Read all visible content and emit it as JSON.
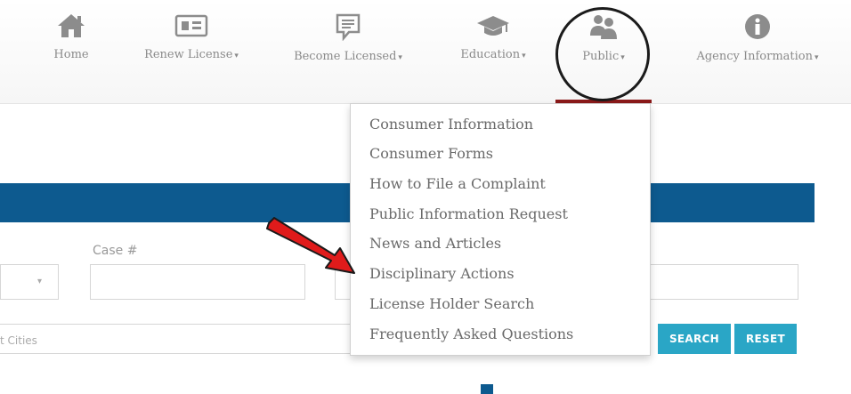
{
  "nav": {
    "items": [
      {
        "label": "Home",
        "icon": "home-icon",
        "has_caret": false
      },
      {
        "label": "Renew License",
        "icon": "id-card-icon",
        "has_caret": true
      },
      {
        "label": "Become Licensed",
        "icon": "document-icon",
        "has_caret": true
      },
      {
        "label": "Education",
        "icon": "graduation-cap-icon",
        "has_caret": true
      },
      {
        "label": "Public",
        "icon": "people-icon",
        "has_caret": true
      },
      {
        "label": "Agency Information",
        "icon": "info-icon",
        "has_caret": true
      }
    ],
    "caret": "▾",
    "active_color": "#8b1a1a"
  },
  "dropdown": {
    "items": [
      "Consumer Information",
      "Consumer Forms",
      "How to File a Complaint",
      "Public Information Request",
      "News and Articles",
      "Disciplinary Actions",
      "License Holder Search",
      "Frequently Asked Questions"
    ]
  },
  "search_form": {
    "case_label": "Case #",
    "cities_label": "t Cities",
    "search_label": "SEARCH",
    "reset_label": "RESET",
    "header_color": "#0d5a8f",
    "button_color": "#2aa6c6"
  },
  "annotations": {
    "circle_color": "#1b1b1b",
    "arrow_color": "#e01b1b"
  }
}
